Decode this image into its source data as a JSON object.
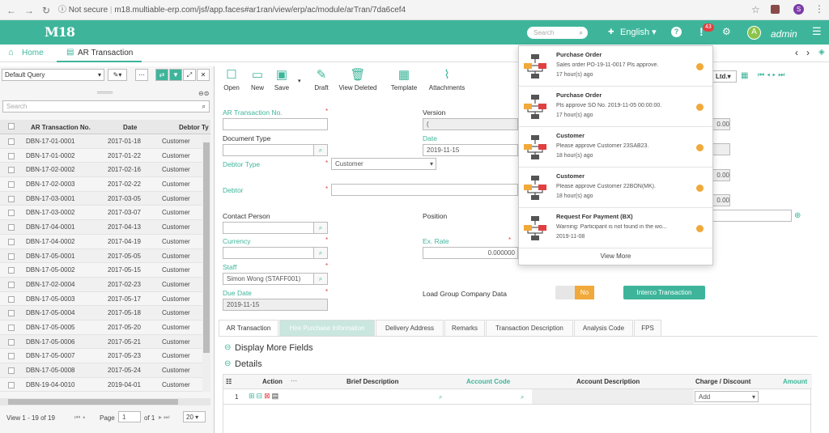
{
  "browser": {
    "url_secure": "Not secure",
    "url": "m18.multiable-erp.com/jsf/app.faces#ar1ran/view/erp/ac/module/arTran/7da6cef4",
    "profile": "S"
  },
  "appbar": {
    "logo": "M18",
    "search_placeholder": "Search",
    "language": "English",
    "badge": "43",
    "avatar": "A",
    "user": "admin"
  },
  "tabs": {
    "home": "Home",
    "current": "AR Transaction"
  },
  "left": {
    "query": "Default Query",
    "search_placeholder": "Search",
    "columns": [
      "AR Transaction No.",
      "Date",
      "Debtor Ty"
    ],
    "rows": [
      [
        "DBN-17-01-0001",
        "2017-01-18",
        "Customer"
      ],
      [
        "DBN-17-01-0002",
        "2017-01-22",
        "Customer"
      ],
      [
        "DBN-17-02-0002",
        "2017-02-16",
        "Customer"
      ],
      [
        "DBN-17-02-0003",
        "2017-02-22",
        "Customer"
      ],
      [
        "DBN-17-03-0001",
        "2017-03-05",
        "Customer"
      ],
      [
        "DBN-17-03-0002",
        "2017-03-07",
        "Customer"
      ],
      [
        "DBN-17-04-0001",
        "2017-04-13",
        "Customer"
      ],
      [
        "DBN-17-04-0002",
        "2017-04-19",
        "Customer"
      ],
      [
        "DBN-17-05-0001",
        "2017-05-05",
        "Customer"
      ],
      [
        "DBN-17-05-0002",
        "2017-05-15",
        "Customer"
      ],
      [
        "DBN-17-02-0004",
        "2017-02-23",
        "Customer"
      ],
      [
        "DBN-17-05-0003",
        "2017-05-17",
        "Customer"
      ],
      [
        "DBN-17-05-0004",
        "2017-05-18",
        "Customer"
      ],
      [
        "DBN-17-05-0005",
        "2017-05-20",
        "Customer"
      ],
      [
        "DBN-17-05-0006",
        "2017-05-21",
        "Customer"
      ],
      [
        "DBN-17-05-0007",
        "2017-05-23",
        "Customer"
      ],
      [
        "DBN-17-05-0008",
        "2017-05-24",
        "Customer"
      ],
      [
        "DBN-19-04-0010",
        "2019-04-01",
        "Customer"
      ]
    ],
    "footer_view": "View 1 - 19 of 19",
    "footer_page": "Page",
    "footer_page_value": "1",
    "footer_of": "of 1",
    "footer_size": "20"
  },
  "toolbar": {
    "open": "Open",
    "new": "New",
    "save": "Save",
    "draft": "Draft",
    "view_deleted": "View Deleted",
    "template": "Template",
    "attachments": "Attachments",
    "ltd": "Ltd."
  },
  "form": {
    "ar_no": "AR Transaction No.",
    "version": "Version",
    "version_value": "(",
    "doc_type": "Document Type",
    "date": "Date",
    "date_value": "2019-11-15",
    "debtor_type": "Debtor Type",
    "debtor_type_value": "Customer",
    "debtor": "Debtor",
    "contact": "Contact Person",
    "position": "Position",
    "currency": "Currency",
    "ex_rate": "Ex. Rate",
    "ex_rate_value": "0.000000",
    "staff": "Staff",
    "staff_value": "Simon Wong (STAFF001)",
    "due_date": "Due Date",
    "due_date_value": "2019-11-15",
    "load_group": "Load Group Company Data",
    "toggle_no": "No",
    "interco": "Interco Transaction",
    "right_vals": [
      "0.00",
      "0.00",
      "0.00",
      "0.00"
    ]
  },
  "detail_tabs": [
    "AR Transaction",
    "Hire Purchase Information",
    "Delivery Address",
    "Remarks",
    "Transaction Description",
    "Analysis Code",
    "FPS"
  ],
  "sections": {
    "more": "Display More Fields",
    "details": "Details"
  },
  "table": {
    "headers": [
      "Action",
      "Brief Description",
      "Account Code",
      "Account Description",
      "Charge / Discount",
      "Amount"
    ],
    "row_no": "1",
    "charge_value": "Add"
  },
  "notifications": [
    {
      "title": "Purchase Order",
      "msg": "Sales order PO-19-11-0017 Pls approve.",
      "time": "17 hour(s) ago"
    },
    {
      "title": "Purchase Order",
      "msg": "Pls approve SO No. 2019-11-05 00:00:00.",
      "time": "17 hour(s) ago"
    },
    {
      "title": "Customer",
      "msg": "Please approve Customer 23SAB23.",
      "time": "18 hour(s) ago"
    },
    {
      "title": "Customer",
      "msg": "Please approve Customer 22BON(MK).",
      "time": "18 hour(s) ago"
    },
    {
      "title": "Request For Payment (BX)",
      "msg": "Warning: Participant is not found in the wo...",
      "time": "2019-11-08"
    }
  ],
  "view_more": "View More",
  "colors": {
    "accent": "#3eb59b",
    "badge": "#e04040",
    "toggle": "#f0a93a"
  }
}
